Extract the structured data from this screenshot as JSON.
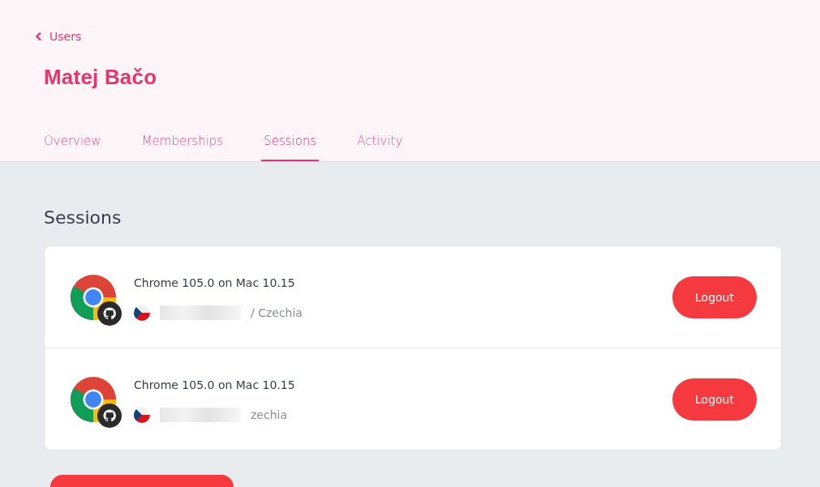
{
  "back_link": {
    "label": "Users"
  },
  "title": "Matej Bačo",
  "tabs": [
    {
      "label": "Overview",
      "selected": false
    },
    {
      "label": "Memberships",
      "selected": false
    },
    {
      "label": "Sessions",
      "selected": true
    },
    {
      "label": "Activity",
      "selected": false
    }
  ],
  "section_title": "Sessions",
  "sessions": [
    {
      "device": "Chrome 105.0 on Mac 10.15",
      "location": "/ Czechia",
      "button": "Logout"
    },
    {
      "device": "Chrome 105.0 on Mac 10.15",
      "location": "zechia",
      "button": "Logout"
    }
  ]
}
